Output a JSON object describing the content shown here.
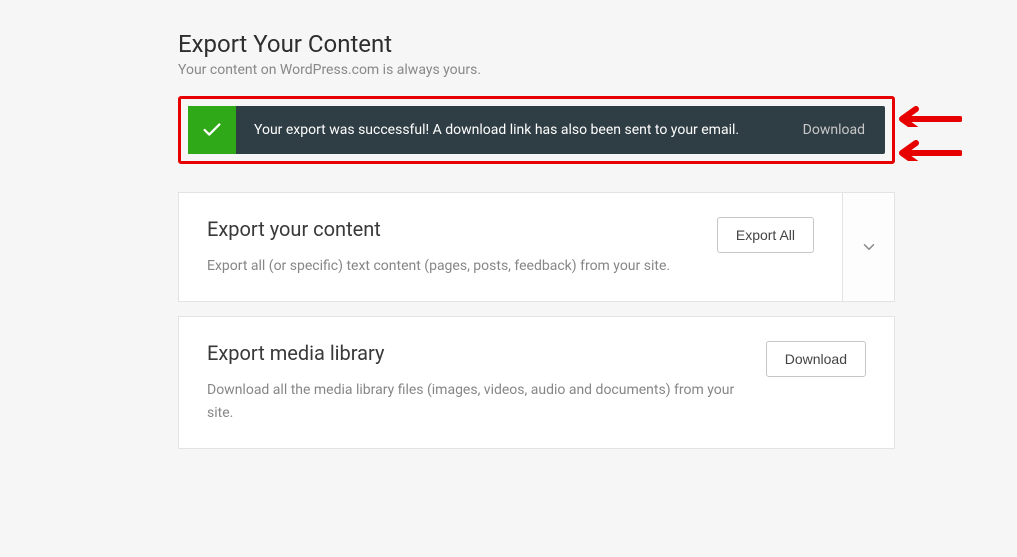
{
  "page": {
    "title": "Export Your Content",
    "subtitle": "Your content on WordPress.com is always yours."
  },
  "notice": {
    "message": "Your export was successful! A download link has also been sent to your email.",
    "action": "Download"
  },
  "card_content": {
    "title": "Export your content",
    "desc": "Export all (or specific) text content (pages, posts, feedback) from your site.",
    "button": "Export All"
  },
  "card_media": {
    "title": "Export media library",
    "desc": "Download all the media library files (images, videos, audio and documents) from your site.",
    "button": "Download"
  }
}
